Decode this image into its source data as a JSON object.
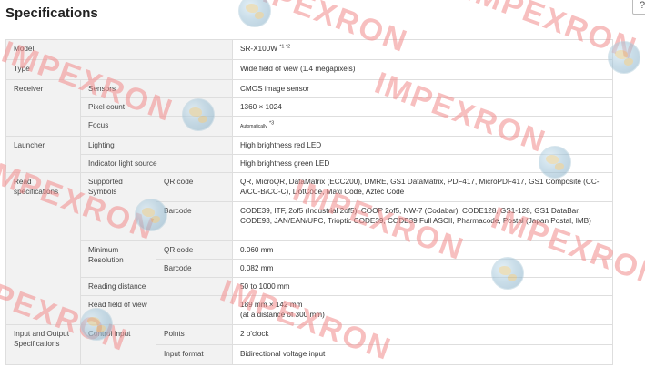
{
  "page": {
    "title": "Specifications",
    "corner_field_value": "?"
  },
  "watermark": {
    "text": "IMPEXRON",
    "color": "#f28b8b"
  },
  "specs": {
    "model_label": "Model",
    "model_value": "SR-X100W",
    "model_notes": "*1 *2",
    "type_label": "Type",
    "type_value": "Wide field of view (1.4 megapixels)",
    "receiver_label": "Receiver",
    "sensors_label": "Sensors",
    "sensors_value": "CMOS image sensor",
    "pixel_count_label": "Pixel count",
    "pixel_count_value": "1360 × 1024",
    "focus_label": "Focus",
    "focus_value": "Automatically",
    "focus_note": "*3",
    "launcher_label": "Launcher",
    "lighting_label": "Lighting",
    "lighting_value": "High brightness red LED",
    "indicator_label": "Indicator light source",
    "indicator_value": "High brightness green LED",
    "read_spec_label": "Read specifications",
    "supported_symbols_label": "Supported Symbols",
    "qr_code_label": "QR code",
    "qr_code_symbols": "QR, MicroQR, DataMatrix (ECC200), DMRE, GS1 DataMatrix, PDF417, MicroPDF417, GS1 Composite (CC-A/CC-B/CC-C), DotCode, Maxi Code, Aztec Code",
    "barcode_label": "Barcode",
    "barcode_symbols": "CODE39, ITF, 2of5 (Industrial 2of5), COOP 2of5, NW-7 (Codabar), CODE128, GS1-128, GS1 DataBar, CODE93, JAN/EAN/UPC, Trioptic CODE39, CODE39 Full ASCII, Pharmacode, Postal (Japan Postal, IMB)",
    "min_res_label": "Minimum Resolution",
    "min_res_qr_label": "QR code",
    "min_res_qr_value": "0.060 mm",
    "min_res_bar_label": "Barcode",
    "min_res_bar_value": "0.082 mm",
    "reading_distance_label": "Reading distance",
    "reading_distance_value": "50 to 1000 mm",
    "read_fov_label": "Read field of view",
    "read_fov_value_1": "189 mm × 142 mm",
    "read_fov_value_2": "(at a distance of 300 mm)",
    "io_label": "Input and Output Specifications",
    "control_input_label": "Control input",
    "points_label": "Points",
    "points_value": "2 o'clock",
    "input_format_label": "Input format",
    "input_format_value": "Bidirectional voltage input"
  }
}
